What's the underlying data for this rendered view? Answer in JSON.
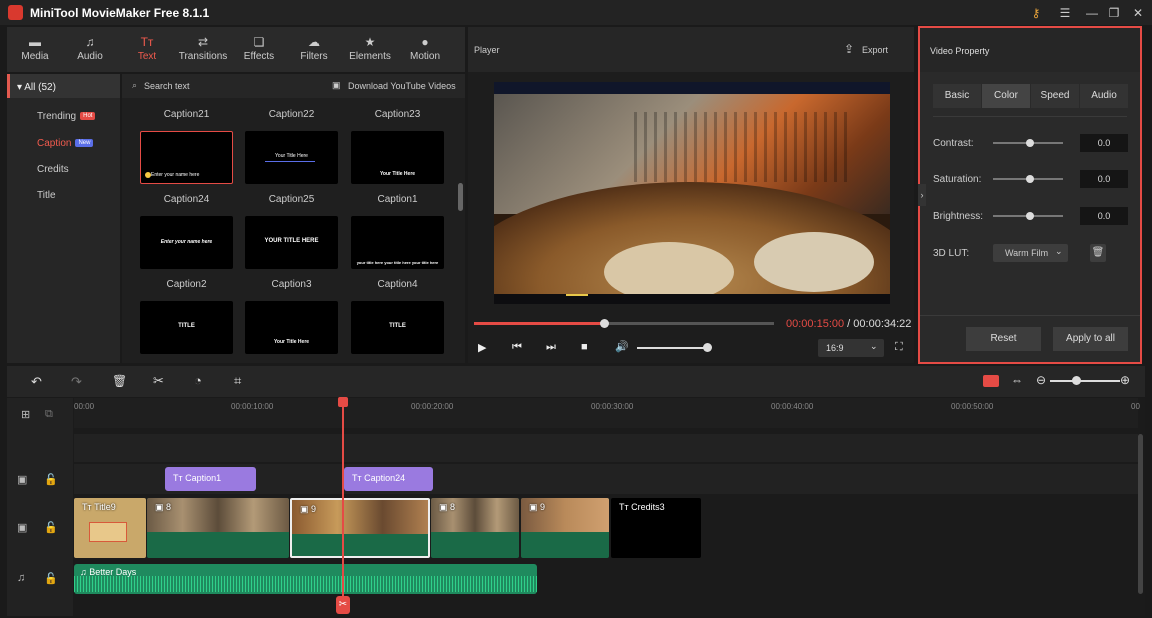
{
  "app": {
    "title": "MiniTool MovieMaker Free 8.1.1"
  },
  "library_tabs": [
    {
      "label": "Media",
      "icon": "media-icon"
    },
    {
      "label": "Audio",
      "icon": "audio-icon"
    },
    {
      "label": "Text",
      "icon": "text-icon"
    },
    {
      "label": "Transitions",
      "icon": "transitions-icon"
    },
    {
      "label": "Effects",
      "icon": "effects-icon"
    },
    {
      "label": "Filters",
      "icon": "filters-icon"
    },
    {
      "label": "Elements",
      "icon": "elements-icon"
    },
    {
      "label": "Motion",
      "icon": "motion-icon"
    }
  ],
  "sidebar": {
    "all_label": "All (52)",
    "items": [
      {
        "label": "Trending",
        "badge": "Hot"
      },
      {
        "label": "Caption",
        "badge": "New"
      },
      {
        "label": "Credits",
        "badge": ""
      },
      {
        "label": "Title",
        "badge": ""
      }
    ]
  },
  "search": {
    "placeholder": "Search text",
    "download_label": "Download YouTube Videos"
  },
  "captions": [
    {
      "name": "Caption21",
      "text": "Enter your name here"
    },
    {
      "name": "Caption22",
      "text": "Your Title Here"
    },
    {
      "name": "Caption23",
      "text": "Your Title Here"
    },
    {
      "name": "Caption24",
      "text": "Enter your name here"
    },
    {
      "name": "Caption25",
      "text": "YOUR TITLE HERE"
    },
    {
      "name": "Caption1",
      "text": "your title here  your title here  your title here"
    },
    {
      "name": "Caption2",
      "text": "TITLE"
    },
    {
      "name": "Caption3",
      "text": "Your Title Here"
    },
    {
      "name": "Caption4",
      "text": "TITLE"
    }
  ],
  "player": {
    "title": "Player",
    "export_label": "Export",
    "time_current": "00:00:15:00",
    "time_sep": " / ",
    "time_total": "00:00:34:22",
    "progress": 0.437,
    "aspect": "16:9"
  },
  "props": {
    "title": "Video Property",
    "tabs": [
      "Basic",
      "Color",
      "Speed",
      "Audio"
    ],
    "active_tab": "Color",
    "contrast_label": "Contrast:",
    "contrast_value": "0.0",
    "saturation_label": "Saturation:",
    "saturation_value": "0.0",
    "brightness_label": "Brightness:",
    "brightness_value": "0.0",
    "lut_label": "3D LUT:",
    "lut_value": "Warm Film",
    "reset_label": "Reset",
    "apply_label": "Apply to all"
  },
  "timeline": {
    "ticks": [
      "00:00",
      "00:00:10:00",
      "00:00:20:00",
      "00:00:30:00",
      "00:00:40:00",
      "00:00:50:00",
      "00"
    ],
    "caption_clips": [
      "Caption1",
      "Caption24"
    ],
    "video_clips": [
      {
        "label": "Title9"
      },
      {
        "label": "8"
      },
      {
        "label": "9"
      },
      {
        "label": "8"
      },
      {
        "label": "9"
      },
      {
        "label": "Credits3"
      }
    ],
    "audio_clip": "Better Days"
  },
  "colors": {
    "accent": "#e54b45",
    "caption_clip": "#9a7ae0",
    "video_track": "#1a6a47",
    "audio_track": "#1f8a5e"
  }
}
